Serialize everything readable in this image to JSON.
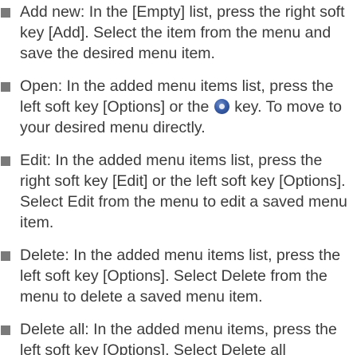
{
  "bullet_color": "#7a7a7a",
  "text_color": "#3b3b3b",
  "items": [
    {
      "text": "Add new: In the [Empty] list, press the right soft key [Add]. Select the item from the menu and save the desired menu item."
    },
    {
      "text_before_icon": "Open: In the added menu items list, press the left soft key [Options] or the ",
      "icon": "center-select-key-icon",
      "text_after_icon": " key. To move to your desired menu directly."
    },
    {
      "text": "Edit: In the added menu items list, press the right soft key [Edit] or the left soft key [Options]. Select Edit from the menu to edit a saved menu item."
    },
    {
      "text": "Delete: In the added menu items list, press the left soft key [Options]. Select Delete from the menu to delete a saved menu item."
    },
    {
      "text": "Delete all: In the added menu items, press the left soft key [Options]. Select Delete all"
    }
  ]
}
